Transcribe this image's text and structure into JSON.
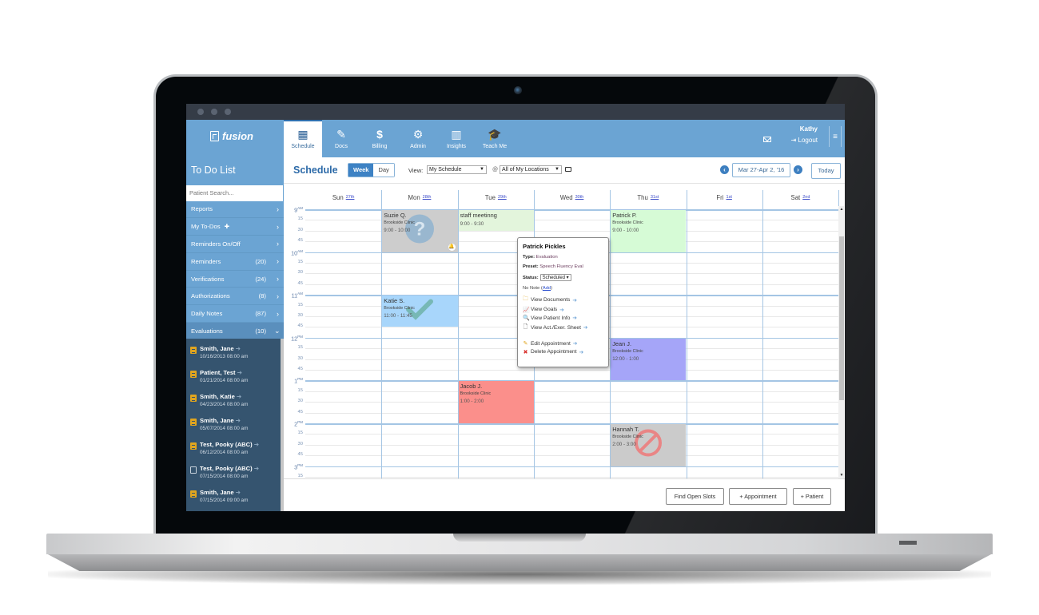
{
  "window": {
    "dots": 3
  },
  "topnav": {
    "logo_text": "fusion",
    "tabs": [
      {
        "label": "Schedule",
        "icon": "calendar-icon",
        "active": true
      },
      {
        "label": "Docs",
        "icon": "pencil-icon",
        "active": false
      },
      {
        "label": "Billing",
        "icon": "dollar-icon",
        "active": false
      },
      {
        "label": "Admin",
        "icon": "gears-icon",
        "active": false
      },
      {
        "label": "Insights",
        "icon": "bar-chart-icon",
        "active": false
      },
      {
        "label": "Teach Me",
        "icon": "graduation-cap-icon",
        "active": false
      }
    ],
    "user_name": "Kathy",
    "logout_label": "Logout",
    "menu_glyph": "≡"
  },
  "sidebar": {
    "title": "To Do List",
    "search_placeholder": "Patient Search...",
    "items": [
      {
        "label": "Reports",
        "count": "",
        "chevron": "›"
      },
      {
        "label": "My To-Dos",
        "count": "",
        "chevron": "›",
        "plus": "✚"
      },
      {
        "label": "Reminders On/Off",
        "count": "",
        "chevron": "›"
      },
      {
        "label": "Reminders",
        "count": "(20)",
        "chevron": "›"
      },
      {
        "label": "Verifications",
        "count": "(24)",
        "chevron": "›"
      },
      {
        "label": "Authorizations",
        "count": "(8)",
        "chevron": "›"
      },
      {
        "label": "Daily Notes",
        "count": "(87)",
        "chevron": "›"
      },
      {
        "label": "Evaluations",
        "count": "(10)",
        "chevron": "⌄"
      }
    ],
    "evaluations": [
      {
        "name": "Smith, Jane",
        "date": "10/16/2013 08:00 am",
        "icon": "filled"
      },
      {
        "name": "Patient, Test",
        "date": "01/21/2014 08:00 am",
        "icon": "filled"
      },
      {
        "name": "Smith, Katie",
        "date": "04/23/2014 08:00 am",
        "icon": "filled"
      },
      {
        "name": "Smith, Jane",
        "date": "05/07/2014 08:00 am",
        "icon": "filled"
      },
      {
        "name": "Test, Pooky (ABC)",
        "date": "06/12/2014 08:00 am",
        "icon": "filled"
      },
      {
        "name": "Test, Pooky (ABC)",
        "date": "07/15/2014 08:00 am",
        "icon": "blank"
      },
      {
        "name": "Smith, Jane",
        "date": "07/15/2014 09:00 am",
        "icon": "filled"
      }
    ]
  },
  "toolbar": {
    "title": "Schedule",
    "week_label": "Week",
    "day_label": "Day",
    "view_label": "View:",
    "view_value": "My Schedule",
    "at_symbol": "@",
    "location_value": "All of My Locations",
    "date_range": "Mar 27-Apr 2, '16",
    "prev_glyph": "‹",
    "next_glyph": "›",
    "today_label": "Today"
  },
  "calendar": {
    "days": [
      {
        "name": "Sun",
        "date": "27th"
      },
      {
        "name": "Mon",
        "date": "28th"
      },
      {
        "name": "Tue",
        "date": "29th"
      },
      {
        "name": "Wed",
        "date": "30th"
      },
      {
        "name": "Thu",
        "date": "31st"
      },
      {
        "name": "Fri",
        "date": "1st"
      },
      {
        "name": "Sat",
        "date": "2nd"
      }
    ],
    "hours": [
      {
        "h": "9",
        "ampm": "AM"
      },
      {
        "h": "10",
        "ampm": "AM"
      },
      {
        "h": "11",
        "ampm": "AM"
      },
      {
        "h": "12",
        "ampm": "PM"
      },
      {
        "h": "1",
        "ampm": "PM"
      },
      {
        "h": "2",
        "ampm": "PM"
      },
      {
        "h": "3",
        "ampm": "PM"
      }
    ],
    "quarter_labels": [
      "15",
      "30",
      "45"
    ],
    "appointments": [
      {
        "day": 1,
        "start": 0,
        "end": 4,
        "name": "Suzie Q.",
        "location": "Brookside Clinic",
        "time": "9:00 - 10:00",
        "color": "#cdcdcd",
        "overlay": "question",
        "alert": true
      },
      {
        "day": 2,
        "start": 0,
        "end": 2,
        "name": "staff meetinng",
        "location": "",
        "time": "9:00 - 9:30",
        "color": "#e3f5dc",
        "overlay": ""
      },
      {
        "day": 4,
        "start": 0,
        "end": 4,
        "name": "Patrick P.",
        "location": "Brookside Clinic",
        "time": "9:00 - 10:00",
        "color": "#d6fbd6",
        "overlay": ""
      },
      {
        "day": 1,
        "start": 8,
        "end": 11,
        "name": "Katie S.",
        "location": "Brookside Clinic",
        "time": "11:00 - 11:45",
        "color": "#a8d6fb",
        "overlay": "check"
      },
      {
        "day": 4,
        "start": 12,
        "end": 16,
        "name": "Jean J.",
        "location": "Brookside Clinic",
        "time": "12:00 - 1:00",
        "color": "#a5a5f8",
        "overlay": ""
      },
      {
        "day": 2,
        "start": 16,
        "end": 20,
        "name": "Jacob J.",
        "location": "Brookside Clinic",
        "time": "1:00 - 2:00",
        "color": "#fb8f8b",
        "overlay": ""
      },
      {
        "day": 4,
        "start": 20,
        "end": 24,
        "name": "Hannah T.",
        "location": "Brookside Clinic",
        "time": "2:00 - 3:00",
        "color": "#cbcbcb",
        "overlay": "cancel"
      }
    ]
  },
  "popover": {
    "title": "Patrick Pickles",
    "type_label": "Type:",
    "type_value": "Evaluation",
    "preset_label": "Preset:",
    "preset_value": "Speech Fluency Eval",
    "status_label": "Status:",
    "status_value": "Scheduled",
    "note_text": "No Note",
    "add_label": "Add",
    "links": [
      {
        "label": "View Documents",
        "icon": "folder-icon"
      },
      {
        "label": "View Goals",
        "icon": "line-chart-icon"
      },
      {
        "label": "View Patient Info",
        "icon": "search-icon"
      },
      {
        "label": "View Act./Exer. Sheet",
        "icon": "file-icon"
      }
    ],
    "actions": [
      {
        "label": "Edit Appointment",
        "icon": "pencil-icon"
      },
      {
        "label": "Delete Appointment",
        "icon": "delete-icon"
      }
    ]
  },
  "footer": {
    "find_open_slots": "Find Open Slots",
    "add_appointment": "+ Appointment",
    "add_patient": "+ Patient"
  }
}
